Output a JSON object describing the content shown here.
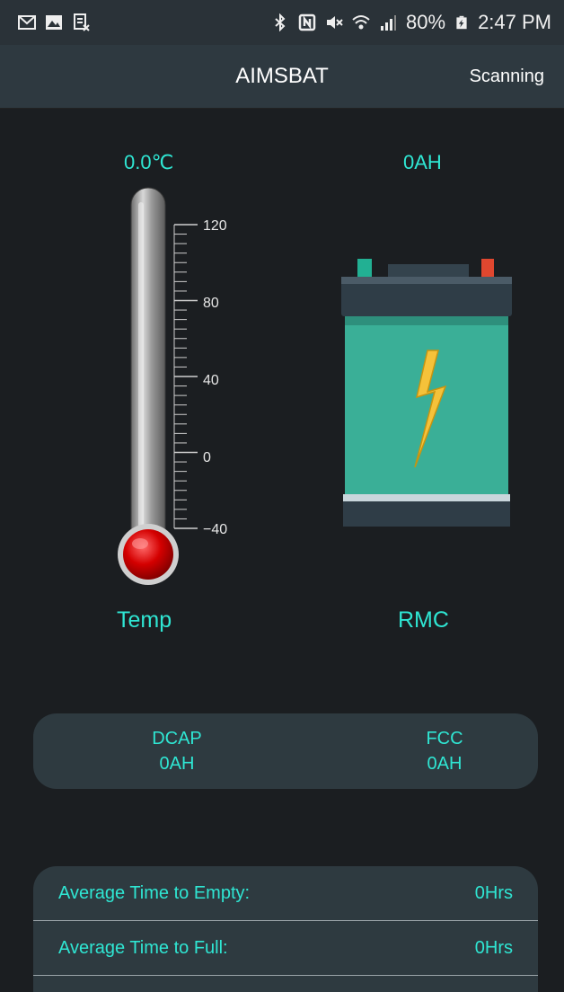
{
  "status_bar": {
    "left_icons": [
      "gmail-icon",
      "gallery-icon",
      "screenshot-icon"
    ],
    "right_icons": [
      "bluetooth-icon",
      "nfc-icon",
      "mute-icon",
      "wifi-icon",
      "signal-icon"
    ],
    "battery_percent": "80%",
    "time": "2:47 PM"
  },
  "app_bar": {
    "title": "AIMSBAT",
    "scan_label": "Scanning"
  },
  "gauges": {
    "temp_value": "0.0℃",
    "temp_label": "Temp",
    "rmc_value": "0AH",
    "rmc_label": "RMC",
    "thermometer_ticks": [
      "120",
      "80",
      "40",
      "0",
      "−40"
    ]
  },
  "capacity": {
    "dcap_label": "DCAP",
    "dcap_value": "0AH",
    "fcc_label": "FCC",
    "fcc_value": "0AH"
  },
  "times": [
    {
      "label": "Average Time to Empty:",
      "value": "0Hrs"
    },
    {
      "label": "Average Time to Full:",
      "value": "0Hrs"
    }
  ],
  "colors": {
    "accent": "#2fe6d3",
    "background": "#1b1e21",
    "card": "#2e3a40",
    "battery_body": "#3aaf97",
    "bolt": "#f5c23a"
  }
}
